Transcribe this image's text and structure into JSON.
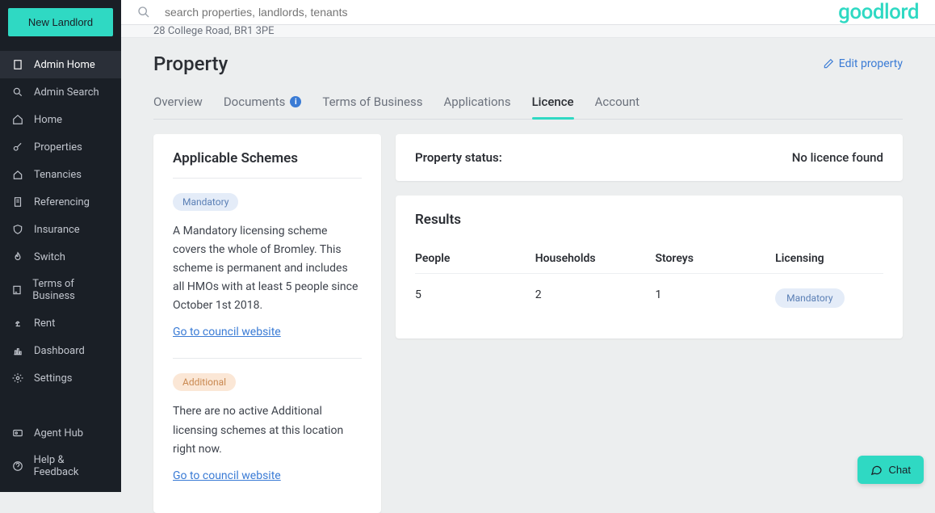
{
  "sidebar": {
    "new_landlord": "New Landlord",
    "items": [
      {
        "label": "Admin Home"
      },
      {
        "label": "Admin Search"
      },
      {
        "label": "Home"
      },
      {
        "label": "Properties"
      },
      {
        "label": "Tenancies"
      },
      {
        "label": "Referencing"
      },
      {
        "label": "Insurance"
      },
      {
        "label": "Switch"
      },
      {
        "label": "Terms of Business"
      },
      {
        "label": "Rent"
      },
      {
        "label": "Dashboard"
      },
      {
        "label": "Settings"
      }
    ],
    "bottom": [
      {
        "label": "Agent Hub"
      },
      {
        "label": "Help & Feedback"
      }
    ]
  },
  "topbar": {
    "search_placeholder": "search properties, landlords, tenants",
    "logo": "goodlord"
  },
  "breadcrumb": "28 College Road, BR1 3PE",
  "page": {
    "title": "Property",
    "edit": "Edit property"
  },
  "tabs": [
    {
      "label": "Overview"
    },
    {
      "label": "Documents",
      "info": true
    },
    {
      "label": "Terms of Business"
    },
    {
      "label": "Applications"
    },
    {
      "label": "Licence",
      "active": true
    },
    {
      "label": "Account"
    }
  ],
  "schemes": {
    "heading": "Applicable Schemes",
    "items": [
      {
        "pill": "Mandatory",
        "pill_class": "blue",
        "text": "A Mandatory licensing scheme covers the whole of Bromley. This scheme is permanent and includes all HMOs with at least 5 people since October 1st 2018.",
        "link": "Go to council website"
      },
      {
        "pill": "Additional",
        "pill_class": "orange",
        "text": "There are no active Additional licensing schemes at this location right now.",
        "link": "Go to council website"
      }
    ]
  },
  "status": {
    "label": "Property status:",
    "value": "No licence found"
  },
  "results": {
    "heading": "Results",
    "columns": [
      "People",
      "Households",
      "Storeys",
      "Licensing"
    ],
    "rows": [
      {
        "people": "5",
        "households": "2",
        "storeys": "1",
        "licensing": "Mandatory"
      }
    ]
  },
  "chat": "Chat"
}
